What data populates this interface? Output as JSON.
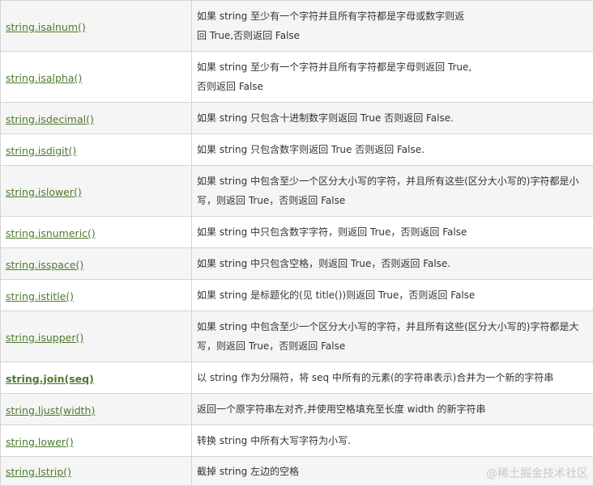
{
  "rows": [
    {
      "method": "string.isalnum()",
      "desc": [
        "如果 string 至少有一个字符并且所有字符都是字母或数字则返",
        "回 True,否则返回 False"
      ]
    },
    {
      "method": "string.isalpha()",
      "desc": [
        "如果 string 至少有一个字符并且所有字符都是字母则返回 True,",
        "否则返回 False"
      ]
    },
    {
      "method": "string.isdecimal()",
      "desc": [
        "如果 string 只包含十进制数字则返回 True 否则返回 False."
      ]
    },
    {
      "method": "string.isdigit()",
      "desc": [
        "如果 string 只包含数字则返回 True 否则返回 False."
      ]
    },
    {
      "method": "string.islower()",
      "desc": [
        "如果 string 中包含至少一个区分大小写的字符，并且所有这些(区分大小写的)字符都是小",
        "写，则返回 True，否则返回 False"
      ]
    },
    {
      "method": "string.isnumeric()",
      "desc": [
        "如果 string 中只包含数字字符，则返回 True，否则返回 False"
      ]
    },
    {
      "method": "string.isspace()",
      "desc": [
        "如果 string 中只包含空格，则返回 True，否则返回 False."
      ]
    },
    {
      "method": "string.istitle()",
      "desc": [
        "如果 string 是标题化的(见 title())则返回 True，否则返回 False"
      ]
    },
    {
      "method": "string.isupper()",
      "desc": [
        "如果 string 中包含至少一个区分大小写的字符，并且所有这些(区分大小写的)字符都是大",
        "写，则返回 True，否则返回 False"
      ]
    },
    {
      "method": "string.join(seq)",
      "bold": true,
      "desc": [
        "以 string 作为分隔符，将 seq 中所有的元素(的字符串表示)合并为一个新的字符串"
      ]
    },
    {
      "method": "string.ljust(width)",
      "desc": [
        "返回一个原字符串左对齐,并使用空格填充至长度 width 的新字符串"
      ]
    },
    {
      "method": "string.lower()",
      "desc": [
        "转换 string 中所有大写字符为小写."
      ]
    },
    {
      "method": "string.lstrip()",
      "desc": [
        "截掉 string 左边的空格"
      ]
    }
  ],
  "watermark": "@稀土掘金技术社区",
  "colors": {
    "link": "#4d7a2e",
    "text": "#333333",
    "border": "#d4d4d4",
    "row_alt": "#f5f5f5"
  }
}
